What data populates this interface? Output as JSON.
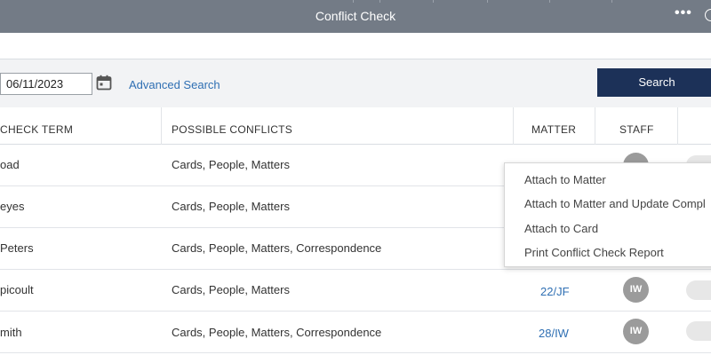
{
  "window": {
    "title": "Conflict Check"
  },
  "toolbar": {
    "date_value": "06/11/2023",
    "advanced_search": "Advanced Search",
    "search_button": "Search"
  },
  "table": {
    "headers": {
      "term": "CHECK TERM",
      "conflicts": "POSSIBLE CONFLICTS",
      "matter": "MATTER",
      "staff": "STAFF"
    },
    "rows": [
      {
        "term": "oad",
        "conflicts": "Cards, People, Matters",
        "matter": "",
        "staff": ""
      },
      {
        "term": "eyes",
        "conflicts": "Cards, People, Matters",
        "matter": "",
        "staff": ""
      },
      {
        "term": "Peters",
        "conflicts": "Cards, People, Matters, Correspondence",
        "matter": "",
        "staff": ""
      },
      {
        "term": "picoult",
        "conflicts": "Cards, People, Matters",
        "matter": "22/JF",
        "staff": "IW"
      },
      {
        "term": "mith",
        "conflicts": "Cards, People, Matters, Correspondence",
        "matter": "28/IW",
        "staff": "IW"
      }
    ]
  },
  "context_menu": {
    "items": [
      "Attach to Matter",
      "Attach to Matter and Update Compl",
      "Attach to Card",
      "Print Conflict Check Report"
    ]
  },
  "colors": {
    "titlebar": "#737b86",
    "search_button": "#1c3158",
    "link": "#2f6fb3",
    "avatar": "#9b9b9b"
  },
  "icons": {
    "more": "more-horizontal-icon",
    "calendar": "calendar-icon"
  }
}
